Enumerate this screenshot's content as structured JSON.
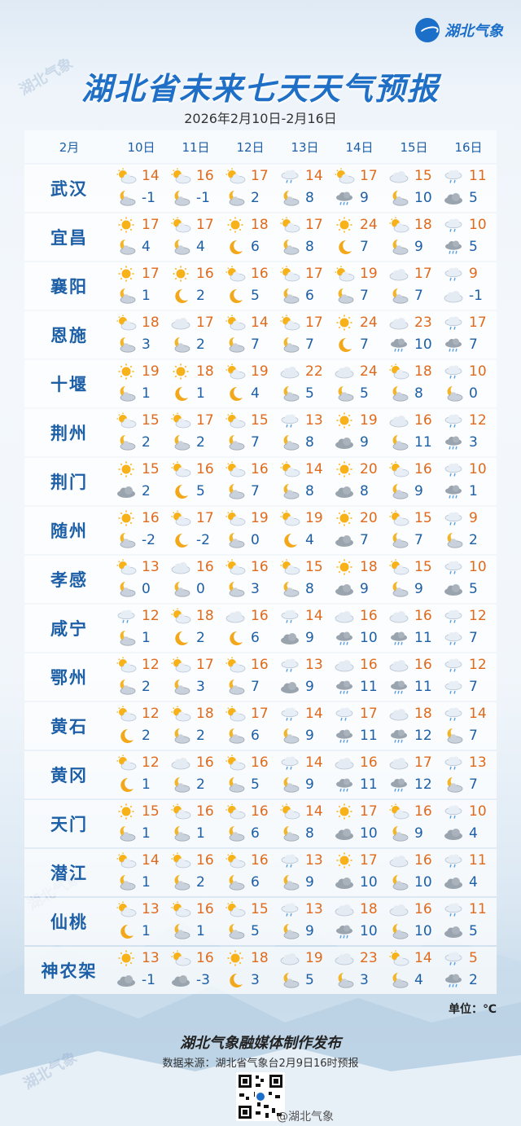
{
  "brand": "湖北气象",
  "watermark": "湖北气象",
  "title": "湖北省未来七天天气预报",
  "date_range": "2026年2月10日-2月16日",
  "month_label": "2月",
  "days": [
    "10日",
    "11日",
    "12日",
    "13日",
    "14日",
    "15日",
    "16日"
  ],
  "rows": [
    {
      "city": "武汉",
      "cells": [
        {
          "dayIcon": "partly-cloudy-day-icon",
          "nightIcon": "cloudy-night-icon",
          "hi": "14",
          "lo": "-1"
        },
        {
          "dayIcon": "partly-cloudy-day-icon",
          "nightIcon": "cloudy-night-icon",
          "hi": "16",
          "lo": "-1"
        },
        {
          "dayIcon": "partly-cloudy-day-icon",
          "nightIcon": "cloudy-night-icon",
          "hi": "17",
          "lo": "2"
        },
        {
          "dayIcon": "light-rain-icon",
          "nightIcon": "cloudy-night-icon",
          "hi": "14",
          "lo": "8"
        },
        {
          "dayIcon": "partly-cloudy-day-icon",
          "nightIcon": "rain-cloud-icon",
          "hi": "17",
          "lo": "9"
        },
        {
          "dayIcon": "cloudy-icon",
          "nightIcon": "cloudy-night-icon",
          "hi": "15",
          "lo": "10"
        },
        {
          "dayIcon": "light-rain-icon",
          "nightIcon": "overcast-icon",
          "hi": "11",
          "lo": "5"
        }
      ]
    },
    {
      "city": "宜昌",
      "cells": [
        {
          "dayIcon": "sunny-icon",
          "nightIcon": "cloudy-night-icon",
          "hi": "17",
          "lo": "4"
        },
        {
          "dayIcon": "partly-cloudy-day-icon",
          "nightIcon": "cloudy-night-icon",
          "hi": "17",
          "lo": "4"
        },
        {
          "dayIcon": "sunny-icon",
          "nightIcon": "moon-icon",
          "hi": "18",
          "lo": "6"
        },
        {
          "dayIcon": "partly-cloudy-day-icon",
          "nightIcon": "cloudy-night-icon",
          "hi": "17",
          "lo": "8"
        },
        {
          "dayIcon": "sunny-icon",
          "nightIcon": "moon-icon",
          "hi": "24",
          "lo": "7"
        },
        {
          "dayIcon": "partly-cloudy-day-icon",
          "nightIcon": "cloudy-night-icon",
          "hi": "18",
          "lo": "9"
        },
        {
          "dayIcon": "light-rain-icon",
          "nightIcon": "rain-cloud-icon",
          "hi": "10",
          "lo": "5"
        }
      ]
    },
    {
      "city": "襄阳",
      "cells": [
        {
          "dayIcon": "sunny-icon",
          "nightIcon": "cloudy-night-icon",
          "hi": "17",
          "lo": "1"
        },
        {
          "dayIcon": "sunny-icon",
          "nightIcon": "moon-icon",
          "hi": "16",
          "lo": "2"
        },
        {
          "dayIcon": "partly-cloudy-day-icon",
          "nightIcon": "moon-icon",
          "hi": "16",
          "lo": "5"
        },
        {
          "dayIcon": "partly-cloudy-day-icon",
          "nightIcon": "cloudy-night-icon",
          "hi": "17",
          "lo": "6"
        },
        {
          "dayIcon": "partly-cloudy-day-icon",
          "nightIcon": "cloudy-night-icon",
          "hi": "19",
          "lo": "7"
        },
        {
          "dayIcon": "cloudy-icon",
          "nightIcon": "cloudy-night-icon",
          "hi": "17",
          "lo": "7"
        },
        {
          "dayIcon": "light-rain-icon",
          "nightIcon": "cloudy-icon",
          "hi": "9",
          "lo": "-1"
        }
      ]
    },
    {
      "city": "恩施",
      "cells": [
        {
          "dayIcon": "partly-cloudy-day-icon",
          "nightIcon": "cloudy-night-icon",
          "hi": "18",
          "lo": "3"
        },
        {
          "dayIcon": "cloudy-icon",
          "nightIcon": "cloudy-night-icon",
          "hi": "17",
          "lo": "2"
        },
        {
          "dayIcon": "partly-cloudy-day-icon",
          "nightIcon": "cloudy-night-icon",
          "hi": "14",
          "lo": "7"
        },
        {
          "dayIcon": "partly-cloudy-day-icon",
          "nightIcon": "cloudy-night-icon",
          "hi": "17",
          "lo": "7"
        },
        {
          "dayIcon": "sunny-icon",
          "nightIcon": "moon-icon",
          "hi": "24",
          "lo": "7"
        },
        {
          "dayIcon": "cloudy-icon",
          "nightIcon": "rain-cloud-icon",
          "hi": "23",
          "lo": "10"
        },
        {
          "dayIcon": "light-rain-icon",
          "nightIcon": "rain-cloud-icon",
          "hi": "17",
          "lo": "7"
        }
      ]
    },
    {
      "city": "十堰",
      "cells": [
        {
          "dayIcon": "sunny-icon",
          "nightIcon": "cloudy-night-icon",
          "hi": "19",
          "lo": "1"
        },
        {
          "dayIcon": "sunny-icon",
          "nightIcon": "moon-icon",
          "hi": "18",
          "lo": "1"
        },
        {
          "dayIcon": "partly-cloudy-day-icon",
          "nightIcon": "moon-icon",
          "hi": "19",
          "lo": "4"
        },
        {
          "dayIcon": "cloudy-icon",
          "nightIcon": "cloudy-night-icon",
          "hi": "22",
          "lo": "5"
        },
        {
          "dayIcon": "cloudy-icon",
          "nightIcon": "cloudy-night-icon",
          "hi": "24",
          "lo": "5"
        },
        {
          "dayIcon": "partly-cloudy-day-icon",
          "nightIcon": "cloudy-night-icon",
          "hi": "18",
          "lo": "8"
        },
        {
          "dayIcon": "light-rain-icon",
          "nightIcon": "cloudy-night-icon",
          "hi": "10",
          "lo": "0"
        }
      ]
    },
    {
      "city": "荆州",
      "cells": [
        {
          "dayIcon": "partly-cloudy-day-icon",
          "nightIcon": "cloudy-night-icon",
          "hi": "15",
          "lo": "2"
        },
        {
          "dayIcon": "partly-cloudy-day-icon",
          "nightIcon": "cloudy-night-icon",
          "hi": "17",
          "lo": "2"
        },
        {
          "dayIcon": "partly-cloudy-day-icon",
          "nightIcon": "cloudy-night-icon",
          "hi": "15",
          "lo": "7"
        },
        {
          "dayIcon": "light-rain-icon",
          "nightIcon": "cloudy-night-icon",
          "hi": "13",
          "lo": "8"
        },
        {
          "dayIcon": "sunny-icon",
          "nightIcon": "overcast-icon",
          "hi": "19",
          "lo": "9"
        },
        {
          "dayIcon": "cloudy-icon",
          "nightIcon": "cloudy-night-icon",
          "hi": "16",
          "lo": "11"
        },
        {
          "dayIcon": "light-rain-icon",
          "nightIcon": "rain-cloud-icon",
          "hi": "12",
          "lo": "3"
        }
      ]
    },
    {
      "city": "荆门",
      "cells": [
        {
          "dayIcon": "sunny-icon",
          "nightIcon": "overcast-icon",
          "hi": "15",
          "lo": "2"
        },
        {
          "dayIcon": "partly-cloudy-day-icon",
          "nightIcon": "moon-icon",
          "hi": "16",
          "lo": "5"
        },
        {
          "dayIcon": "partly-cloudy-day-icon",
          "nightIcon": "cloudy-night-icon",
          "hi": "16",
          "lo": "7"
        },
        {
          "dayIcon": "partly-cloudy-day-icon",
          "nightIcon": "cloudy-night-icon",
          "hi": "14",
          "lo": "8"
        },
        {
          "dayIcon": "sunny-icon",
          "nightIcon": "overcast-icon",
          "hi": "20",
          "lo": "8"
        },
        {
          "dayIcon": "partly-cloudy-day-icon",
          "nightIcon": "cloudy-night-icon",
          "hi": "16",
          "lo": "9"
        },
        {
          "dayIcon": "light-rain-icon",
          "nightIcon": "rain-cloud-icon",
          "hi": "10",
          "lo": "1"
        }
      ]
    },
    {
      "city": "随州",
      "cells": [
        {
          "dayIcon": "sunny-icon",
          "nightIcon": "cloudy-night-icon",
          "hi": "16",
          "lo": "-2"
        },
        {
          "dayIcon": "partly-cloudy-day-icon",
          "nightIcon": "moon-icon",
          "hi": "17",
          "lo": "-2"
        },
        {
          "dayIcon": "partly-cloudy-day-icon",
          "nightIcon": "cloudy-night-icon",
          "hi": "19",
          "lo": "0"
        },
        {
          "dayIcon": "partly-cloudy-day-icon",
          "nightIcon": "moon-icon",
          "hi": "19",
          "lo": "4"
        },
        {
          "dayIcon": "sunny-icon",
          "nightIcon": "overcast-icon",
          "hi": "20",
          "lo": "7"
        },
        {
          "dayIcon": "partly-cloudy-day-icon",
          "nightIcon": "cloudy-night-icon",
          "hi": "15",
          "lo": "7"
        },
        {
          "dayIcon": "light-rain-icon",
          "nightIcon": "cloudy-night-icon",
          "hi": "9",
          "lo": "2"
        }
      ]
    },
    {
      "city": "孝感",
      "cells": [
        {
          "dayIcon": "partly-cloudy-day-icon",
          "nightIcon": "cloudy-night-icon",
          "hi": "13",
          "lo": "0"
        },
        {
          "dayIcon": "cloudy-icon",
          "nightIcon": "cloudy-night-icon",
          "hi": "16",
          "lo": "0"
        },
        {
          "dayIcon": "partly-cloudy-day-icon",
          "nightIcon": "cloudy-night-icon",
          "hi": "16",
          "lo": "3"
        },
        {
          "dayIcon": "partly-cloudy-day-icon",
          "nightIcon": "cloudy-night-icon",
          "hi": "15",
          "lo": "8"
        },
        {
          "dayIcon": "sunny-icon",
          "nightIcon": "overcast-icon",
          "hi": "18",
          "lo": "9"
        },
        {
          "dayIcon": "partly-cloudy-day-icon",
          "nightIcon": "cloudy-night-icon",
          "hi": "15",
          "lo": "9"
        },
        {
          "dayIcon": "light-rain-icon",
          "nightIcon": "overcast-icon",
          "hi": "10",
          "lo": "5"
        }
      ]
    },
    {
      "city": "咸宁",
      "cells": [
        {
          "dayIcon": "light-rain-icon",
          "nightIcon": "cloudy-night-icon",
          "hi": "12",
          "lo": "1"
        },
        {
          "dayIcon": "partly-cloudy-day-icon",
          "nightIcon": "moon-icon",
          "hi": "18",
          "lo": "2"
        },
        {
          "dayIcon": "cloudy-icon",
          "nightIcon": "moon-icon",
          "hi": "16",
          "lo": "6"
        },
        {
          "dayIcon": "light-rain-icon",
          "nightIcon": "overcast-icon",
          "hi": "14",
          "lo": "9"
        },
        {
          "dayIcon": "cloudy-icon",
          "nightIcon": "rain-cloud-icon",
          "hi": "16",
          "lo": "10"
        },
        {
          "dayIcon": "cloudy-icon",
          "nightIcon": "rain-cloud-icon",
          "hi": "16",
          "lo": "11"
        },
        {
          "dayIcon": "light-rain-icon",
          "nightIcon": "light-rain-icon",
          "hi": "12",
          "lo": "7"
        }
      ]
    },
    {
      "city": "鄂州",
      "cells": [
        {
          "dayIcon": "partly-cloudy-day-icon",
          "nightIcon": "cloudy-night-icon",
          "hi": "12",
          "lo": "2"
        },
        {
          "dayIcon": "partly-cloudy-day-icon",
          "nightIcon": "cloudy-night-icon",
          "hi": "17",
          "lo": "3"
        },
        {
          "dayIcon": "partly-cloudy-day-icon",
          "nightIcon": "cloudy-night-icon",
          "hi": "16",
          "lo": "7"
        },
        {
          "dayIcon": "light-rain-icon",
          "nightIcon": "overcast-icon",
          "hi": "13",
          "lo": "9"
        },
        {
          "dayIcon": "cloudy-icon",
          "nightIcon": "rain-cloud-icon",
          "hi": "16",
          "lo": "11"
        },
        {
          "dayIcon": "cloudy-icon",
          "nightIcon": "rain-cloud-icon",
          "hi": "16",
          "lo": "11"
        },
        {
          "dayIcon": "light-rain-icon",
          "nightIcon": "light-rain-icon",
          "hi": "12",
          "lo": "7"
        }
      ]
    },
    {
      "city": "黄石",
      "cells": [
        {
          "dayIcon": "partly-cloudy-day-icon",
          "nightIcon": "moon-icon",
          "hi": "12",
          "lo": "2"
        },
        {
          "dayIcon": "partly-cloudy-day-icon",
          "nightIcon": "cloudy-night-icon",
          "hi": "18",
          "lo": "2"
        },
        {
          "dayIcon": "partly-cloudy-day-icon",
          "nightIcon": "cloudy-night-icon",
          "hi": "17",
          "lo": "6"
        },
        {
          "dayIcon": "light-rain-icon",
          "nightIcon": "cloudy-night-icon",
          "hi": "14",
          "lo": "9"
        },
        {
          "dayIcon": "light-rain-icon",
          "nightIcon": "rain-cloud-icon",
          "hi": "17",
          "lo": "11"
        },
        {
          "dayIcon": "cloudy-icon",
          "nightIcon": "rain-cloud-icon",
          "hi": "18",
          "lo": "12"
        },
        {
          "dayIcon": "light-rain-icon",
          "nightIcon": "cloudy-night-icon",
          "hi": "14",
          "lo": "7"
        }
      ]
    },
    {
      "city": "黄冈",
      "cells": [
        {
          "dayIcon": "partly-cloudy-day-icon",
          "nightIcon": "moon-icon",
          "hi": "12",
          "lo": "1"
        },
        {
          "dayIcon": "cloudy-icon",
          "nightIcon": "cloudy-night-icon",
          "hi": "16",
          "lo": "2"
        },
        {
          "dayIcon": "partly-cloudy-day-icon",
          "nightIcon": "cloudy-night-icon",
          "hi": "16",
          "lo": "5"
        },
        {
          "dayIcon": "light-rain-icon",
          "nightIcon": "cloudy-night-icon",
          "hi": "14",
          "lo": "9"
        },
        {
          "dayIcon": "cloudy-icon",
          "nightIcon": "rain-cloud-icon",
          "hi": "16",
          "lo": "11"
        },
        {
          "dayIcon": "cloudy-icon",
          "nightIcon": "rain-cloud-icon",
          "hi": "17",
          "lo": "12"
        },
        {
          "dayIcon": "light-rain-icon",
          "nightIcon": "cloudy-night-icon",
          "hi": "13",
          "lo": "7"
        }
      ]
    },
    {
      "city": "天门",
      "cells": [
        {
          "dayIcon": "sunny-icon",
          "nightIcon": "cloudy-night-icon",
          "hi": "15",
          "lo": "1"
        },
        {
          "dayIcon": "partly-cloudy-day-icon",
          "nightIcon": "cloudy-night-icon",
          "hi": "16",
          "lo": "1"
        },
        {
          "dayIcon": "partly-cloudy-day-icon",
          "nightIcon": "cloudy-night-icon",
          "hi": "16",
          "lo": "6"
        },
        {
          "dayIcon": "partly-cloudy-day-icon",
          "nightIcon": "cloudy-night-icon",
          "hi": "14",
          "lo": "8"
        },
        {
          "dayIcon": "sunny-icon",
          "nightIcon": "overcast-icon",
          "hi": "17",
          "lo": "10"
        },
        {
          "dayIcon": "partly-cloudy-day-icon",
          "nightIcon": "cloudy-night-icon",
          "hi": "16",
          "lo": "9"
        },
        {
          "dayIcon": "light-rain-icon",
          "nightIcon": "overcast-icon",
          "hi": "10",
          "lo": "4"
        }
      ]
    },
    {
      "city": "潜江",
      "cells": [
        {
          "dayIcon": "partly-cloudy-day-icon",
          "nightIcon": "cloudy-night-icon",
          "hi": "14",
          "lo": "1"
        },
        {
          "dayIcon": "partly-cloudy-day-icon",
          "nightIcon": "cloudy-night-icon",
          "hi": "16",
          "lo": "2"
        },
        {
          "dayIcon": "partly-cloudy-day-icon",
          "nightIcon": "cloudy-night-icon",
          "hi": "16",
          "lo": "6"
        },
        {
          "dayIcon": "light-rain-icon",
          "nightIcon": "cloudy-night-icon",
          "hi": "13",
          "lo": "9"
        },
        {
          "dayIcon": "sunny-icon",
          "nightIcon": "overcast-icon",
          "hi": "17",
          "lo": "10"
        },
        {
          "dayIcon": "cloudy-icon",
          "nightIcon": "cloudy-night-icon",
          "hi": "16",
          "lo": "10"
        },
        {
          "dayIcon": "light-rain-icon",
          "nightIcon": "overcast-icon",
          "hi": "11",
          "lo": "4"
        }
      ]
    },
    {
      "city": "仙桃",
      "cells": [
        {
          "dayIcon": "partly-cloudy-day-icon",
          "nightIcon": "moon-icon",
          "hi": "13",
          "lo": "1"
        },
        {
          "dayIcon": "partly-cloudy-day-icon",
          "nightIcon": "cloudy-night-icon",
          "hi": "16",
          "lo": "1"
        },
        {
          "dayIcon": "partly-cloudy-day-icon",
          "nightIcon": "cloudy-night-icon",
          "hi": "15",
          "lo": "5"
        },
        {
          "dayIcon": "light-rain-icon",
          "nightIcon": "cloudy-night-icon",
          "hi": "13",
          "lo": "9"
        },
        {
          "dayIcon": "cloudy-icon",
          "nightIcon": "rain-cloud-icon",
          "hi": "18",
          "lo": "10"
        },
        {
          "dayIcon": "cloudy-icon",
          "nightIcon": "cloudy-night-icon",
          "hi": "16",
          "lo": "10"
        },
        {
          "dayIcon": "light-rain-icon",
          "nightIcon": "overcast-icon",
          "hi": "11",
          "lo": "5"
        }
      ]
    },
    {
      "city": "神农架",
      "cells": [
        {
          "dayIcon": "sunny-icon",
          "nightIcon": "overcast-icon",
          "hi": "13",
          "lo": "-1"
        },
        {
          "dayIcon": "partly-cloudy-day-icon",
          "nightIcon": "overcast-icon",
          "hi": "16",
          "lo": "-3"
        },
        {
          "dayIcon": "sunny-icon",
          "nightIcon": "moon-icon",
          "hi": "18",
          "lo": "3"
        },
        {
          "dayIcon": "cloudy-icon",
          "nightIcon": "cloudy-night-icon",
          "hi": "19",
          "lo": "5"
        },
        {
          "dayIcon": "cloudy-icon",
          "nightIcon": "cloudy-night-icon",
          "hi": "23",
          "lo": "3"
        },
        {
          "dayIcon": "partly-cloudy-day-icon",
          "nightIcon": "cloudy-night-icon",
          "hi": "14",
          "lo": "4"
        },
        {
          "dayIcon": "light-rain-icon",
          "nightIcon": "rain-cloud-icon",
          "hi": "5",
          "lo": "2"
        }
      ]
    }
  ],
  "unit_label": "单位：℃",
  "footer_title": "湖北气象融媒体制作发布",
  "footer_source": "数据来源：湖北省气象台2月9日16时预报",
  "weibo_label": "@湖北气象",
  "colors": {
    "title": "#1f6fc7",
    "high": "#e06a1c",
    "low": "#1d5fa6",
    "city": "#1d5fa6"
  }
}
